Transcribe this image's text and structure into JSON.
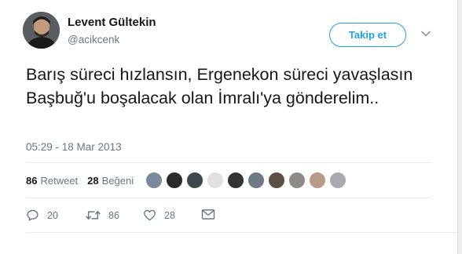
{
  "tweet": {
    "author_name": "Levent Gültekin",
    "handle": "@acikcenk",
    "follow_label": "Takip et",
    "text": "Barış süreci hızlansın, Ergenekon süreci yavaşlasın Başbuğ'u boşalacak olan İmralı'ya gönderelim..",
    "timestamp": "05:29 - 18 Mar 2013"
  },
  "stats": {
    "retweet_count": "86",
    "retweet_label": "Retweet",
    "like_count": "28",
    "like_label": "Beğeni"
  },
  "liker_avatar_colors": [
    "#7b8a9a",
    "#2b2b2b",
    "#3d4750",
    "#e0e0e0",
    "#333333",
    "#6f7a86",
    "#5a5048",
    "#8e8a86",
    "#b89a8a",
    "#a8aab0"
  ],
  "actions": {
    "reply_count": "20",
    "retweet_count": "86",
    "like_count": "28"
  },
  "colors": {
    "accent": "#1da1f2",
    "muted": "#657786"
  }
}
